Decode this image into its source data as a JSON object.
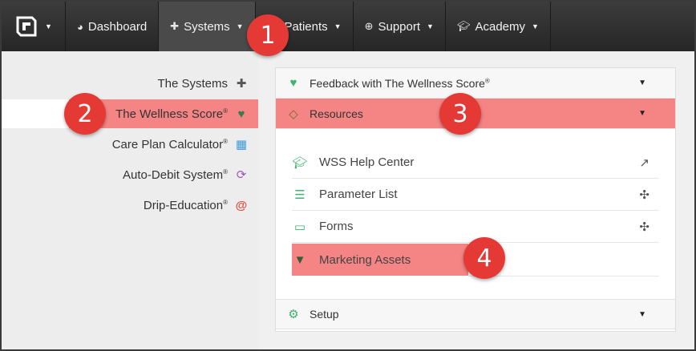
{
  "navbar": {
    "items": [
      {
        "label": "Dashboard",
        "icon": "dashboard-icon"
      },
      {
        "label": "Systems",
        "icon": "puzzle-icon"
      },
      {
        "label": "Patients",
        "icon": "user-icon"
      },
      {
        "label": "Support",
        "icon": "lifebuoy-icon"
      },
      {
        "label": "Academy",
        "icon": "graduation-cap-icon"
      }
    ]
  },
  "sidebar": {
    "items": [
      {
        "label": "The Systems",
        "reg": "",
        "icon": "puzzle-icon"
      },
      {
        "label": "The Wellness Score",
        "reg": "®",
        "icon": "heart-icon"
      },
      {
        "label": "Care Plan Calculator",
        "reg": "®",
        "icon": "calculator-icon"
      },
      {
        "label": "Auto-Debit System",
        "reg": "®",
        "icon": "refresh-icon"
      },
      {
        "label": "Drip-Education",
        "reg": "®",
        "icon": "at-icon"
      }
    ]
  },
  "main": {
    "sections": [
      {
        "label": "Feedback with The Wellness Score",
        "reg": "®",
        "icon": "heartbeat-icon"
      },
      {
        "label": "Resources",
        "reg": "",
        "icon": "diamond-icon"
      },
      {
        "label": "Setup",
        "reg": "",
        "icon": "gears-icon"
      }
    ],
    "resources": [
      {
        "label": "WSS Help Center",
        "icon": "graduation-cap-icon",
        "right_icon": "external-link-icon"
      },
      {
        "label": "Parameter List",
        "icon": "list-icon",
        "right_icon": "pinwheel-icon"
      },
      {
        "label": "Forms",
        "icon": "folder-open-icon",
        "right_icon": "pinwheel-icon"
      },
      {
        "label": "Marketing Assets",
        "icon": "filter-icon",
        "right_icon": ""
      }
    ]
  },
  "badges": [
    "1",
    "2",
    "3",
    "4"
  ],
  "colors": {
    "highlight": "#f58585",
    "badge": "#e53935",
    "navbar": "#2e2e2e",
    "green_icon": "#3cb371"
  }
}
